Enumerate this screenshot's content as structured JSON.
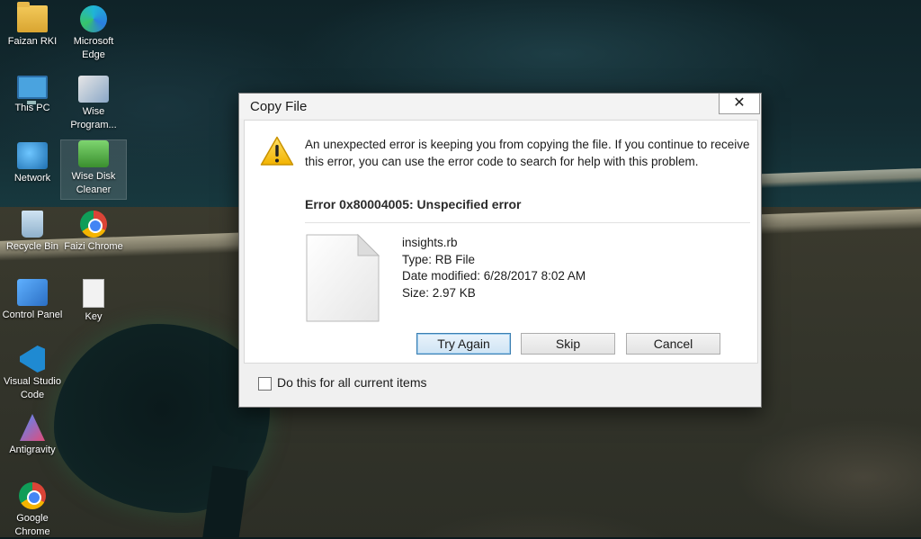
{
  "desktop": {
    "icons": [
      {
        "label": "Faizan RKI",
        "icon": "folder-icon"
      },
      {
        "label": "Microsoft Edge",
        "icon": "edge-icon"
      },
      {
        "label": "This PC",
        "icon": "computer-icon"
      },
      {
        "label": "Wise Program...",
        "icon": "installer-icon"
      },
      {
        "label": "Network",
        "icon": "network-icon"
      },
      {
        "label": "Wise Disk Cleaner",
        "icon": "disk-cleaner-icon"
      },
      {
        "label": "Recycle Bin",
        "icon": "recycle-bin-icon"
      },
      {
        "label": "Faizi Chrome",
        "icon": "chrome-icon"
      },
      {
        "label": "Control Panel",
        "icon": "control-panel-icon"
      },
      {
        "label": "Key",
        "icon": "text-file-icon"
      },
      {
        "label": "Visual Studio Code",
        "icon": "vscode-icon"
      },
      {
        "label": "Antigravity",
        "icon": "antigravity-icon"
      },
      {
        "label": "Google Chrome",
        "icon": "chrome-icon"
      }
    ]
  },
  "dialog": {
    "title": "Copy File",
    "close_glyph": "✕",
    "message": "An unexpected error is keeping you from copying the file. If you continue to receive this error, you can use the error code to search for help with this problem.",
    "error_code": "Error 0x80004005: Unspecified error",
    "file": {
      "name": "insights.rb",
      "type": "Type: RB File",
      "modified": "Date modified: 6/28/2017 8:02 AM",
      "size": "Size: 2.97 KB"
    },
    "buttons": {
      "try_again": "Try Again",
      "skip": "Skip",
      "cancel": "Cancel"
    },
    "checkbox": {
      "label": "Do this for all current items",
      "checked": false
    }
  },
  "colors": {
    "default_button_border": "#3c7fb1",
    "warning_yellow": "#f7c52b"
  }
}
